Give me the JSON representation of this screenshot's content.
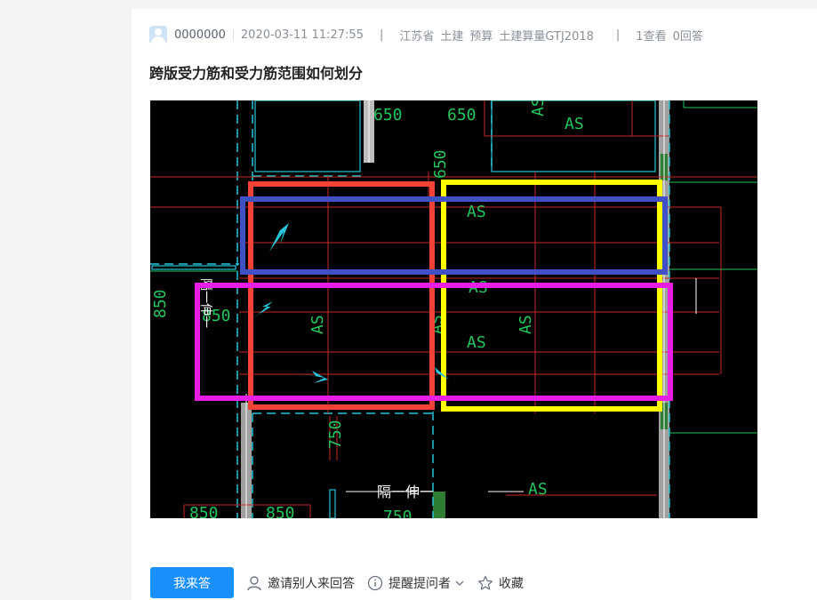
{
  "question": {
    "author": "0000000",
    "timestamp": "2020-03-11 11:27:55",
    "separator": "|",
    "tags": [
      "江苏省",
      "土建",
      "预算",
      "土建算量GTJ2018"
    ],
    "stats": {
      "views": "1查看",
      "answers": "0回答"
    },
    "title": "跨版受力筋和受力筋范围如何划分"
  },
  "drawing": {
    "labels": {
      "dim_650a": "650",
      "dim_650b": "650",
      "dim_650c": "650",
      "dim_850a": "850",
      "dim_850b": "850",
      "dim_850c": "850",
      "dim_850d": "850",
      "dim_750a": "750",
      "dim_750b": "750",
      "as": "AS",
      "partition": "隔一伸一"
    },
    "colors": {
      "red_box": "#f44336",
      "yellow_box": "#ffff00",
      "blue_box": "#3f51c5",
      "magenta_box": "#e91ee6",
      "cyan_arrow": "#26c6da",
      "cad_green": "#22c55e",
      "cad_red": "#c62828",
      "cad_cyan": "#26c6da"
    }
  },
  "actions": {
    "answer_button": "我来答",
    "invite_label": "邀请别人来回答",
    "remind_label": "提醒提问者",
    "favorite_label": "收藏"
  }
}
